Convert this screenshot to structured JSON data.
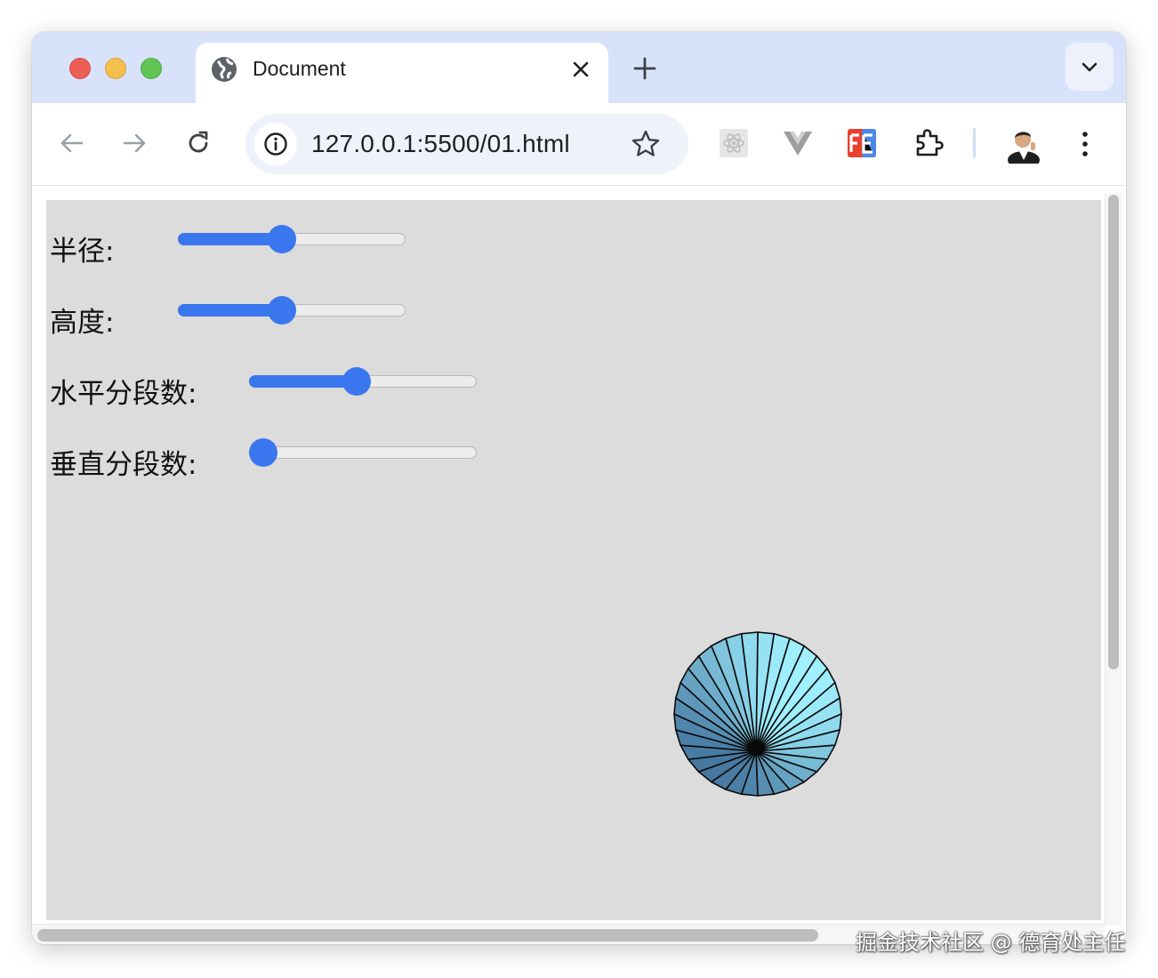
{
  "browser": {
    "tab": {
      "title": "Document",
      "favicon": "globe-icon"
    },
    "address_bar": {
      "url": "127.0.0.1:5500/01.html"
    },
    "extensions": [
      "react-devtools-icon",
      "vue-devtools-icon",
      "fe-helper-icon",
      "extensions-puzzle-icon"
    ],
    "colors": {
      "titlebar": "#d8e3fb",
      "accent": "#3a76ee",
      "page_bg": "#dcdcdc"
    }
  },
  "controls": [
    {
      "label": "半径:",
      "value": 0.45
    },
    {
      "label": "高度:",
      "value": 0.45
    },
    {
      "label": "水平分段数:",
      "value": 0.47
    },
    {
      "label": "垂直分段数:",
      "value": 0.0
    }
  ],
  "scene": {
    "object": "cone",
    "segments": 32,
    "base_color": "#7fd0f5"
  },
  "watermark": "掘金技术社区 @ 德育处主任"
}
